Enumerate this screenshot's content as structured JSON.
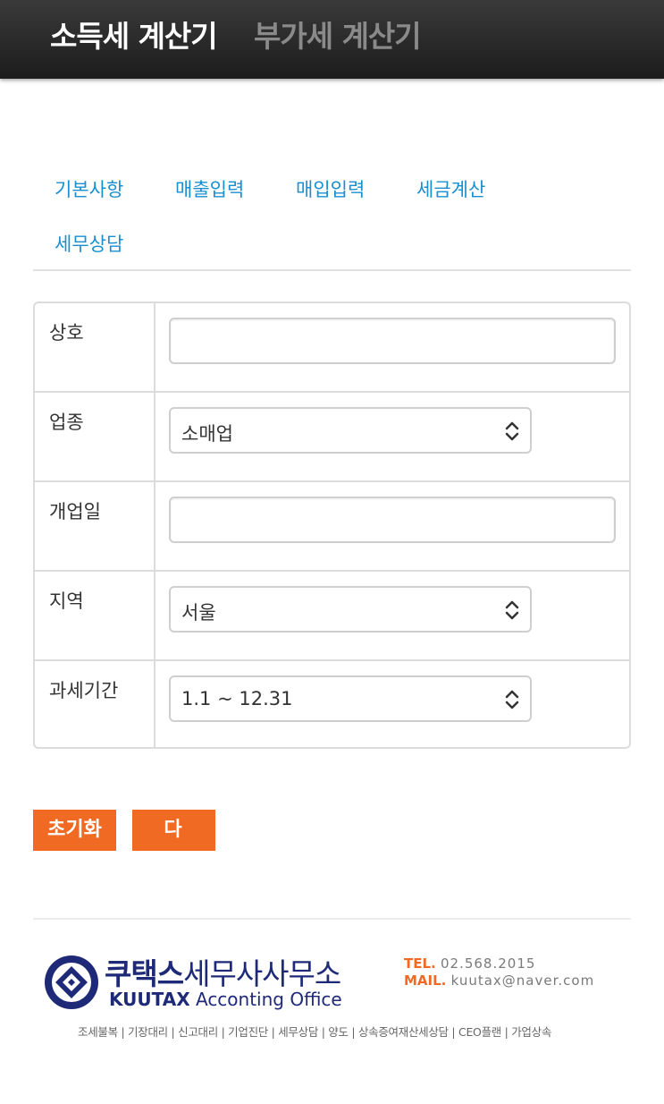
{
  "header": {
    "active_tab": "소득세 계산기",
    "inactive_tab": "부가세 계산기"
  },
  "tabs": [
    "기본사항",
    "매출입력",
    "매입입력",
    "세금계산",
    "세무상담"
  ],
  "form": {
    "rows": [
      {
        "label": "상호",
        "type": "input",
        "value": ""
      },
      {
        "label": "업종",
        "type": "select",
        "value": "소매업"
      },
      {
        "label": "개업일",
        "type": "input",
        "value": ""
      },
      {
        "label": "지역",
        "type": "select",
        "value": "서울"
      },
      {
        "label": "과세기간",
        "type": "select",
        "value": "1.1 ~ 12.31"
      }
    ]
  },
  "buttons": {
    "reset": "초기화",
    "next": "다 음"
  },
  "footer": {
    "brand_bold": "쿠택스",
    "brand_rest": "세무사사무소",
    "brand_en_bold": "KUUTAX",
    "brand_en_rest": " Acconting Office",
    "tel_label": "TEL.",
    "tel_value": "02.568.2015",
    "mail_label": "MAIL.",
    "mail_value": "kuutax@naver.com",
    "services": "조세불복 | 기장대리 | 신고대리 | 기업진단 | 세무상담 | 양도 | 상속증여재산세상담 | CEO플랜 | 가업상속"
  },
  "colors": {
    "accent": "#f06a23",
    "tab_link": "#1a8fd0",
    "brand": "#1e2a78"
  }
}
